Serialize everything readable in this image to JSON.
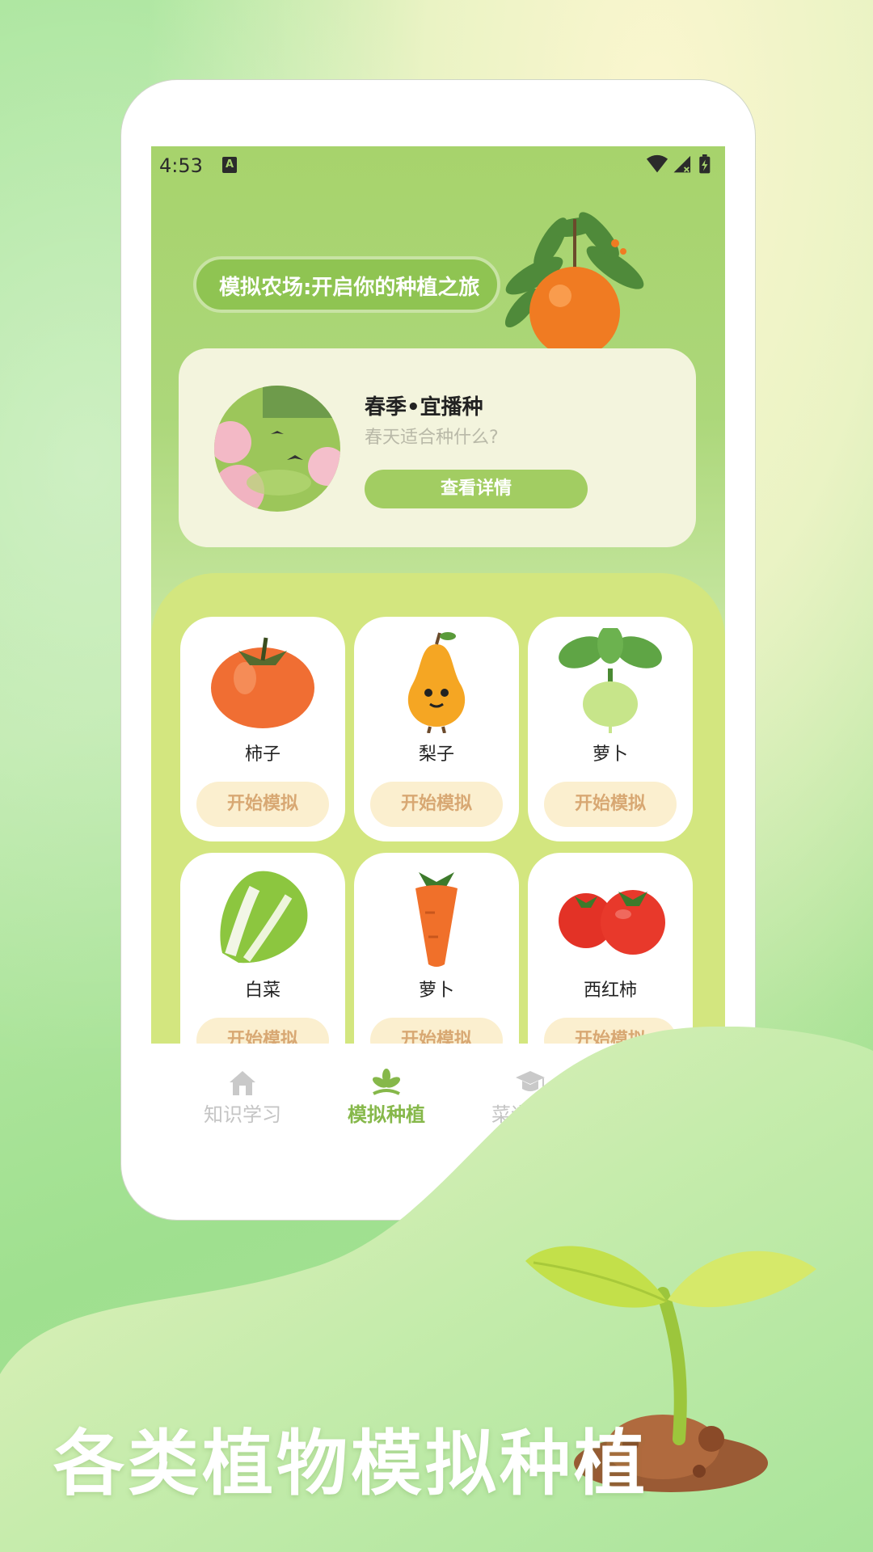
{
  "status_bar": {
    "time": "4:53",
    "notification_badge": "A"
  },
  "banner": {
    "title": "模拟农场:开启你的种植之旅"
  },
  "season_card": {
    "title": "春季•宜播种",
    "subtitle": "春天适合种什么?",
    "detail_button": "查看详情"
  },
  "plants": [
    {
      "name": "柿子",
      "button": "开始模拟",
      "icon": "persimmon-icon"
    },
    {
      "name": "梨子",
      "button": "开始模拟",
      "icon": "pear-icon"
    },
    {
      "name": "萝卜",
      "button": "开始模拟",
      "icon": "turnip-icon"
    },
    {
      "name": "白菜",
      "button": "开始模拟",
      "icon": "cabbage-icon"
    },
    {
      "name": "萝卜",
      "button": "开始模拟",
      "icon": "carrot-icon"
    },
    {
      "name": "西红柿",
      "button": "开始模拟",
      "icon": "tomato-icon"
    }
  ],
  "tabs": [
    {
      "label": "知识学习",
      "icon": "home-icon",
      "active": false
    },
    {
      "label": "模拟种植",
      "icon": "sprout-icon",
      "active": true
    },
    {
      "label": "菜谱学习",
      "icon": "graduation-cap-icon",
      "active": false
    }
  ],
  "promo": {
    "headline": "各类植物模拟种植"
  },
  "colors": {
    "accent_green": "#86b84a",
    "button_green": "#a2cd62",
    "start_button_bg": "#fbefcf",
    "start_button_text": "#d8a873"
  }
}
